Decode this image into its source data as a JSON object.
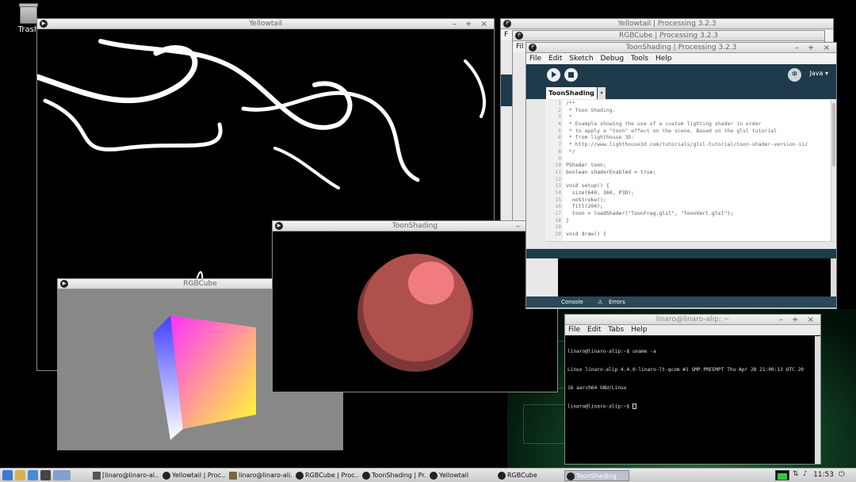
{
  "desktop": {
    "trash_label": "Trash"
  },
  "windows": {
    "yellowtail_sketch": {
      "title": "Yellowtail",
      "controls": "– + ×"
    },
    "rgbcube_sketch": {
      "title": "RGBCube",
      "controls": "– + ×"
    },
    "toonshading_sketch": {
      "title": "ToonShading",
      "controls": "– + ×"
    },
    "pde_yellowtail": {
      "title": "Yellowtail | Processing 3.2.3"
    },
    "pde_rgbcube": {
      "title": "RGBCube | Processing 3.2.3"
    },
    "pde_toon": {
      "title": "ToonShading | Processing 3.2.3",
      "controls": "– + ×",
      "menu": [
        "File",
        "Edit",
        "Sketch",
        "Debug",
        "Tools",
        "Help"
      ],
      "mode": "Java ▾",
      "mode_icon": "butterfly-icon",
      "tab": "ToonShading",
      "tab_arrow": "▾",
      "console_tab": "Console",
      "errors_tab": "Errors",
      "line_numbers": [
        "1",
        "2",
        "3",
        "4",
        "5",
        "6",
        "7",
        "8",
        "9",
        "10",
        "11",
        "12",
        "13",
        "14",
        "15",
        "16",
        "17",
        "18",
        "19",
        "20"
      ],
      "code_lines": [
        "/**",
        " * Toon Shading.",
        " *",
        " * Example showing the use of a custom lighting shader in order",
        " * to apply a \"toon\" effect on the scene. Based on the glsl tutorial",
        " * from lighthouse 3D:",
        " * http://www.lighthouse3d.com/tutorials/glsl-tutorial/toon-shader-version-ii/",
        " */",
        "",
        "PShader toon;",
        "boolean shaderEnabled = true;",
        "",
        "void setup() {",
        "  size(640, 360, P3D);",
        "  noStroke();",
        "  fill(204);",
        "  toon = loadShader(\"ToonFrag.glsl\", \"ToonVert.glsl\");",
        "}",
        "",
        "void draw() {"
      ]
    },
    "terminal": {
      "title": "linaro@linaro-alip: ~",
      "controls": "– + ×",
      "menu": [
        "File",
        "Edit",
        "Tabs",
        "Help"
      ],
      "lines": [
        "linaro@linaro-alip:~$ uname -a",
        "Linux linaro-alip 4.4.0-linaro-lt-qcom #1 SMP PREEMPT Thu Apr 28 21:00:13 UTC 20",
        "16 aarch64 GNU/Linux",
        "linaro@linaro-alip:~$ "
      ]
    }
  },
  "taskbar": {
    "tasks": [
      "[linaro@linaro-al...",
      "Yellowtail | Proc...",
      "linaro@linaro-ali...",
      "RGBCube | Proc...",
      "ToonShading | Pr...",
      "Yellowtail",
      "RGBCube",
      "ToonShading"
    ],
    "clock": "11:53"
  },
  "colors": {
    "pde_dark": "#1f3a4a",
    "sphere": "#b0504c",
    "sphere_highlight": "#f07c80",
    "cube_bg": "#888888"
  }
}
